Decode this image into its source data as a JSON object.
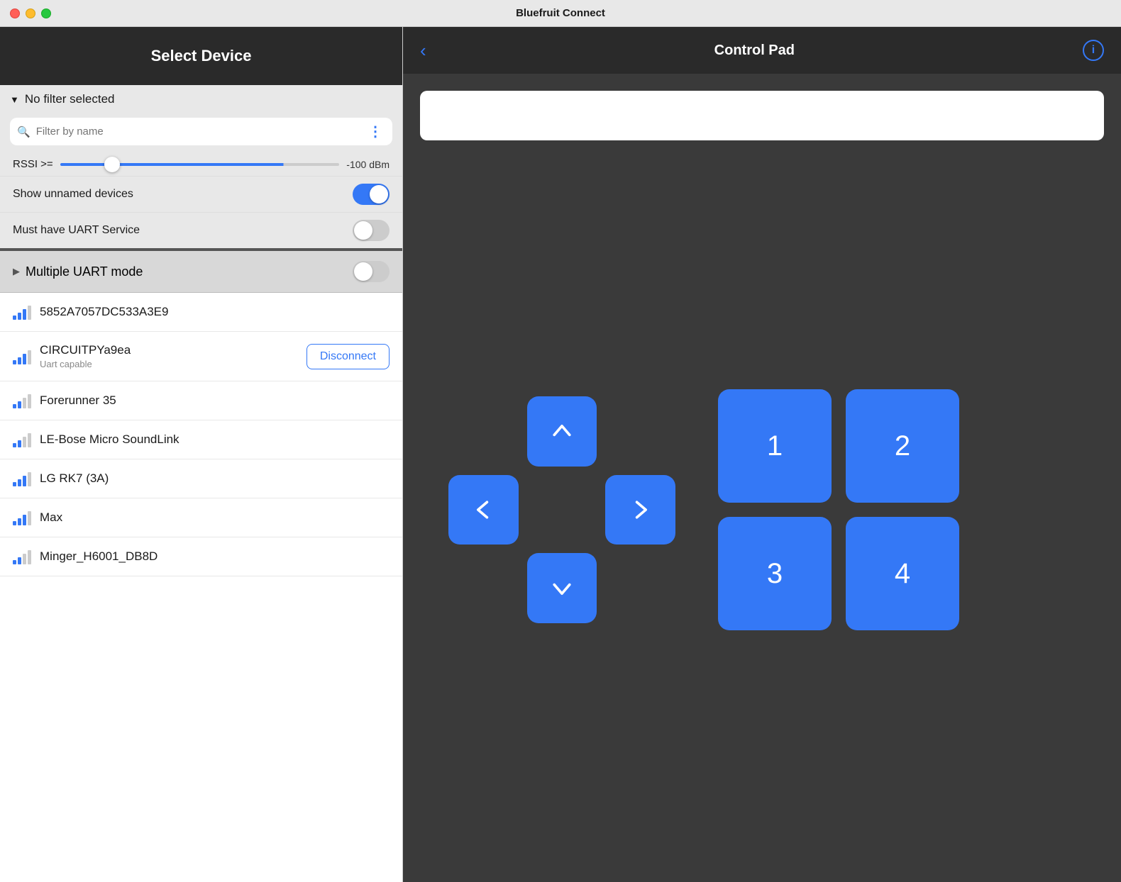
{
  "titlebar": {
    "title": "Bluefruit Connect"
  },
  "left_panel": {
    "header": "Select Device",
    "filter_label": "No filter selected",
    "search_placeholder": "Filter by name",
    "rssi_label": "RSSI >=",
    "rssi_value": "-100 dBm",
    "show_unnamed_label": "Show unnamed devices",
    "show_unnamed_on": true,
    "must_have_uart_label": "Must have UART Service",
    "must_have_uart_on": false,
    "multiple_uart_label": "Multiple UART mode",
    "multiple_uart_on": false
  },
  "devices": [
    {
      "name": "5852A7057DC533A3E9",
      "sub": "",
      "signal": 3,
      "connected": false
    },
    {
      "name": "CIRCUITPYa9ea",
      "sub": "Uart capable",
      "signal": 3,
      "connected": true
    },
    {
      "name": "Forerunner 35",
      "sub": "",
      "signal": 2,
      "connected": false
    },
    {
      "name": "LE-Bose Micro SoundLink",
      "sub": "",
      "signal": 2,
      "connected": false
    },
    {
      "name": "LG RK7  (3A)",
      "sub": "",
      "signal": 3,
      "connected": false
    },
    {
      "name": "Max",
      "sub": "",
      "signal": 3,
      "connected": false
    },
    {
      "name": "Minger_H6001_DB8D",
      "sub": "",
      "signal": 2,
      "connected": false
    }
  ],
  "disconnect_label": "Disconnect",
  "right_panel": {
    "title": "Control Pad",
    "back_label": "‹"
  },
  "dpad": {
    "up_label": "↑",
    "down_label": "↓",
    "left_label": "←",
    "right_label": "→"
  },
  "num_buttons": [
    "1",
    "2",
    "3",
    "4"
  ]
}
